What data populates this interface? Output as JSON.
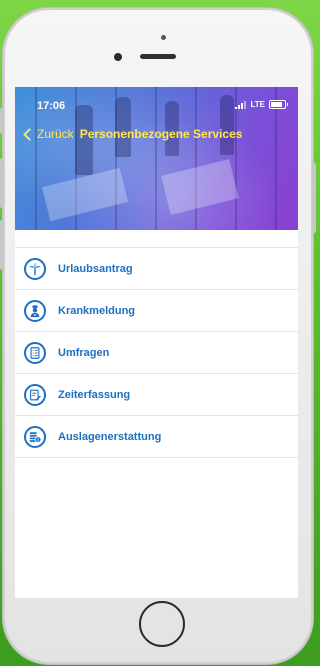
{
  "status_bar": {
    "time": "17:06",
    "network": "LTE"
  },
  "nav": {
    "back_label": "Zurück",
    "title": "Personenbezogene Services"
  },
  "items": [
    {
      "label": "Urlaubsantrag",
      "icon": "palm-tree-icon"
    },
    {
      "label": "Krankmeldung",
      "icon": "nurse-icon"
    },
    {
      "label": "Umfragen",
      "icon": "survey-icon"
    },
    {
      "label": "Zeiterfassung",
      "icon": "timesheet-icon"
    },
    {
      "label": "Auslagenerstattung",
      "icon": "expense-icon"
    }
  ],
  "colors": {
    "accent": "#1d6fc4",
    "nav_text": "#ffe94a",
    "background": "#5cc22e"
  }
}
